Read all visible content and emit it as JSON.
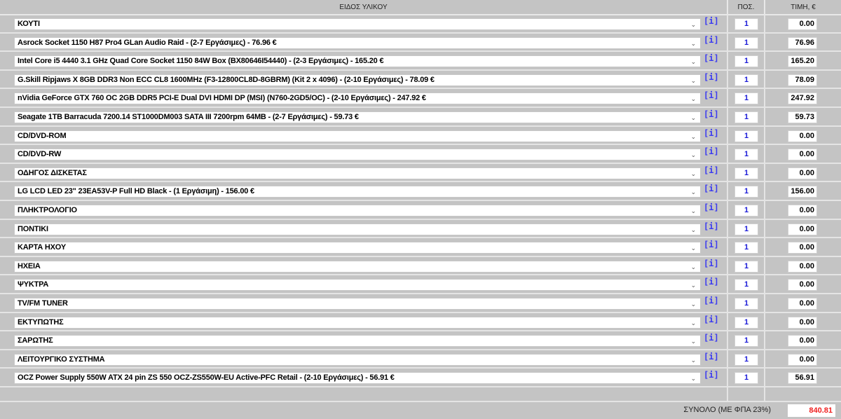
{
  "header": {
    "item": "ΕΙΔΟΣ ΥΛΙΚΟΥ",
    "qty": "ΠΟΣ.",
    "price": "ΤΙΜΗ, €"
  },
  "info_label": "[i]",
  "rows": [
    {
      "item": "ΚΟΥΤΙ",
      "qty": "1",
      "price": "0.00"
    },
    {
      "item": "Asrock Socket 1150 H87 Pro4 GLan Audio Raid - (2-7 Εργάσιμες) - 76.96 €",
      "qty": "1",
      "price": "76.96"
    },
    {
      "item": "Intel Core i5 4440 3.1 GHz Quad Core Socket 1150 84W Box (BX80646I54440) - (2-3 Εργάσιμες) - 165.20 €",
      "qty": "1",
      "price": "165.20"
    },
    {
      "item": "G.Skill Ripjaws X 8GB DDR3 Non ECC CL8 1600MHz (F3-12800CL8D-8GBRM) (Kit 2 x 4096) - (2-10 Εργάσιμες) - 78.09 €",
      "qty": "1",
      "price": "78.09"
    },
    {
      "item": "nVidia GeForce GTX 760 OC 2GB DDR5 PCI-E Dual DVI HDMI DP (MSI) (N760-2GD5/OC) - (2-10 Εργάσιμες) - 247.92 €",
      "qty": "1",
      "price": "247.92"
    },
    {
      "item": "Seagate 1TB Barracuda 7200.14 ST1000DM003 SATA III 7200rpm 64MB - (2-7 Εργάσιμες) - 59.73 €",
      "qty": "1",
      "price": "59.73"
    },
    {
      "item": "CD/DVD-ROM",
      "qty": "1",
      "price": "0.00"
    },
    {
      "item": "CD/DVD-RW",
      "qty": "1",
      "price": "0.00"
    },
    {
      "item": "ΟΔΗΓΟΣ ΔΙΣΚΕΤΑΣ",
      "qty": "1",
      "price": "0.00"
    },
    {
      "item": "LG LCD LED 23\" 23EA53V-P Full HD Black - (1 Εργάσιμη) - 156.00 €",
      "qty": "1",
      "price": "156.00"
    },
    {
      "item": "ΠΛΗΚΤΡΟΛΟΓΙΟ",
      "qty": "1",
      "price": "0.00"
    },
    {
      "item": "ΠΟΝΤΙΚΙ",
      "qty": "1",
      "price": "0.00"
    },
    {
      "item": "ΚΑΡΤΑ ΗΧΟΥ",
      "qty": "1",
      "price": "0.00"
    },
    {
      "item": "ΗΧΕΙΑ",
      "qty": "1",
      "price": "0.00"
    },
    {
      "item": "ΨΥΚΤΡΑ",
      "qty": "1",
      "price": "0.00"
    },
    {
      "item": "TV/FM TUNER",
      "qty": "1",
      "price": "0.00"
    },
    {
      "item": "ΕΚΤΥΠΩΤΗΣ",
      "qty": "1",
      "price": "0.00"
    },
    {
      "item": "ΣΑΡΩΤΗΣ",
      "qty": "1",
      "price": "0.00"
    },
    {
      "item": "ΛΕΙΤΟΥΡΓΙΚΟ ΣΥΣΤΗΜΑ",
      "qty": "1",
      "price": "0.00"
    },
    {
      "item": "OCZ Power Supply 550W ATX 24 pin ZS 550 OCZ-ZS550W-EU Active-PFC Retail - (2-10 Εργάσιμες) - 56.91 €",
      "qty": "1",
      "price": "56.91"
    }
  ],
  "total": {
    "label": "ΣΥΝΟΛΟ (ΜΕ ΦΠΑ 23%)",
    "value": "840.81"
  }
}
